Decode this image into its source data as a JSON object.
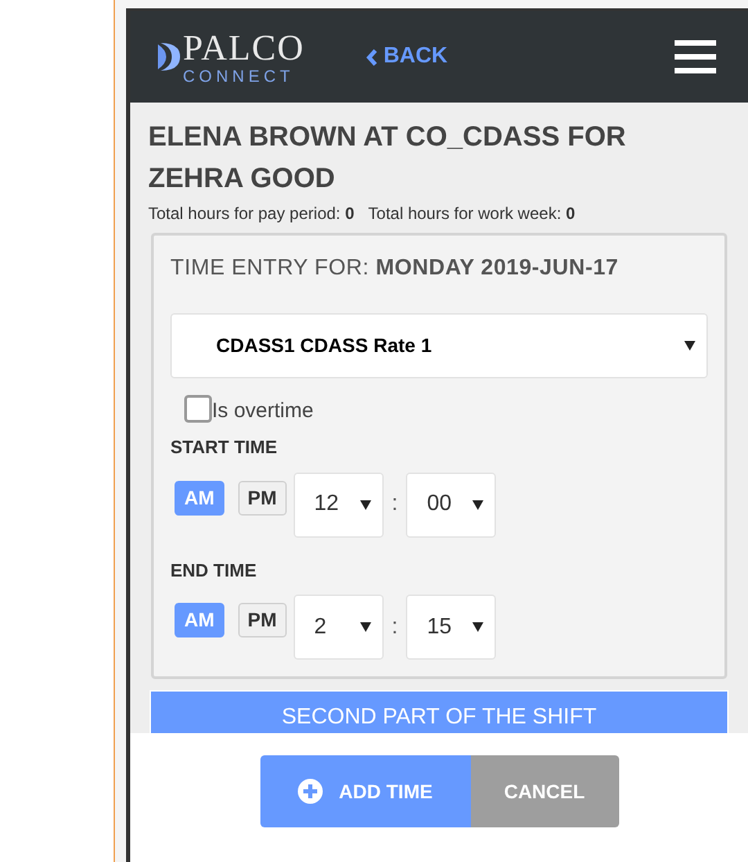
{
  "header": {
    "logo_name": "PALCO",
    "logo_tagline": "CONNECT",
    "back": "BACK"
  },
  "title": "ELENA BROWN AT CO_CDASS FOR ZEHRA GOOD",
  "totals": [
    "Total hours for pay period: **0**",
    "Total hours for work week: **0**"
  ],
  "card": {
    "heading": "TIME ENTRY FOR: **MONDAY 2019-JUN-17**",
    "rate": {
      "value": "CDASS1 CDASS Rate 1"
    },
    "overtime": {
      "label": "Is overtime",
      "checked": false
    },
    "times": [
      {
        "label": "START TIME",
        "periods": [
          {
            "label": "AM",
            "selected": true
          },
          {
            "label": "PM",
            "selected": false
          }
        ],
        "hour": "12",
        "separator": ":",
        "minute": "00"
      },
      {
        "label": "END TIME",
        "periods": [
          {
            "label": "AM",
            "selected": true
          },
          {
            "label": "PM",
            "selected": false
          }
        ],
        "hour": "2",
        "separator": ":",
        "minute": "15"
      }
    ]
  },
  "banner": "SECOND PART OF THE SHIFT",
  "buttons": [
    {
      "label": "ADD TIME",
      "kind": "primary"
    },
    {
      "label": "CANCEL",
      "kind": "secondary"
    }
  ]
}
